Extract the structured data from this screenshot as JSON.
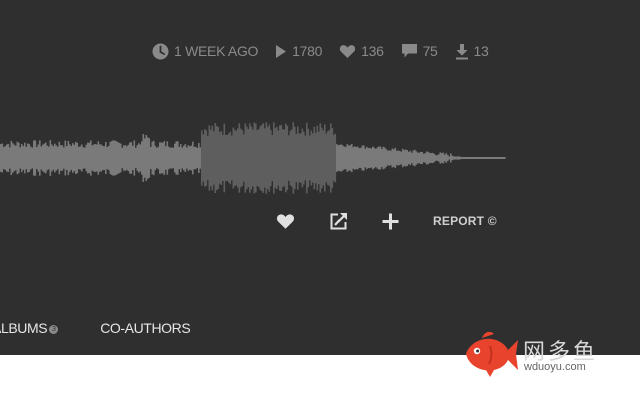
{
  "stats": {
    "posted": "1 WEEK AGO",
    "plays": "1780",
    "likes": "136",
    "comments": "75",
    "downloads": "13"
  },
  "actions": {
    "report_label": "REPORT ©"
  },
  "tabs": [
    {
      "label": "ALBUMS",
      "count": "3"
    },
    {
      "label": "CO-AUTHORS"
    }
  ],
  "watermark": {
    "brand_cn": "网多鱼",
    "url": "wduoyu.com"
  },
  "colors": {
    "background": "#2f2f2f",
    "stat_text": "#8a8a8a",
    "waveform": "#7a7a7a",
    "waveform_highlight": "#5e5e5e",
    "action_text": "#e0e0e0",
    "watermark_fish": "#e8442d"
  },
  "icons": {
    "posted": "clock-icon",
    "plays": "play-icon",
    "likes": "heart-icon",
    "comments": "comment-icon",
    "downloads": "download-icon",
    "like_action": "heart-icon",
    "share_action": "share-icon",
    "add_action": "plus-icon"
  }
}
